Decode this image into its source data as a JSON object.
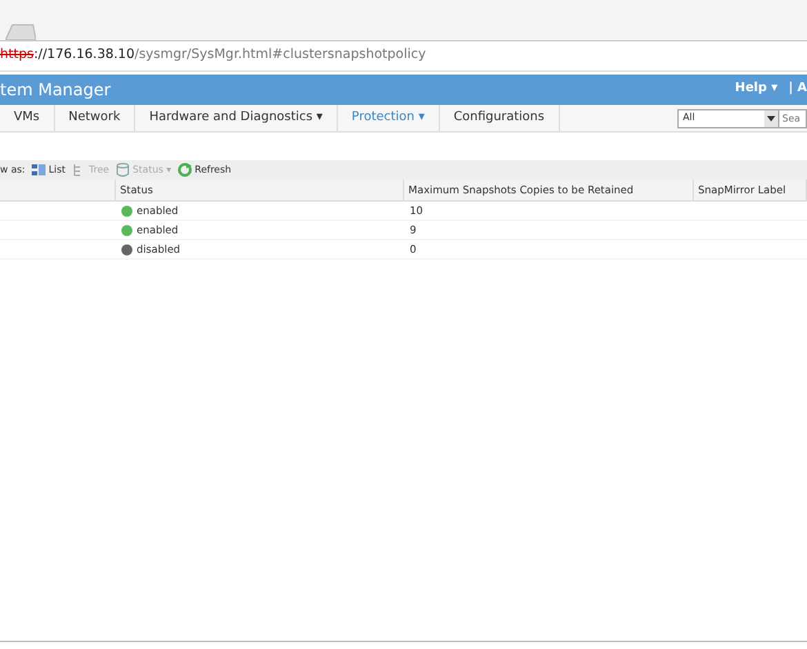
{
  "address_bar": {
    "scheme": "https",
    "host": "://176.16.38.10",
    "path": "/sysmgr/SysMgr.html#clustersnapshotpolicy"
  },
  "header": {
    "title": "tem Manager",
    "help": "Help",
    "help_caret": "▾",
    "next": "| A"
  },
  "nav": {
    "items": [
      {
        "label": "VMs",
        "dropdown": false,
        "selected": false
      },
      {
        "label": "Network",
        "dropdown": false,
        "selected": false
      },
      {
        "label": "Hardware and Diagnostics",
        "dropdown": true,
        "selected": false
      },
      {
        "label": "Protection",
        "dropdown": true,
        "selected": true
      },
      {
        "label": "Configurations",
        "dropdown": false,
        "selected": false
      }
    ],
    "caret": "▾",
    "filter": {
      "value": "All"
    },
    "search": {
      "placeholder": "Sea"
    }
  },
  "toolbar": {
    "label": "w as:",
    "items": [
      {
        "kind": "list",
        "label": "List",
        "disabled": false
      },
      {
        "kind": "tree",
        "label": "Tree",
        "disabled": true
      },
      {
        "kind": "status",
        "label": "Status",
        "disabled": true
      },
      {
        "kind": "refresh",
        "label": "Refresh",
        "disabled": false
      }
    ]
  },
  "table": {
    "columns": [
      "Status",
      "Maximum Snapshots Copies to be Retained",
      "SnapMirror Label"
    ],
    "rows": [
      {
        "enabled": true,
        "status": "enabled",
        "max": "10"
      },
      {
        "enabled": true,
        "status": "enabled",
        "max": "9"
      },
      {
        "enabled": false,
        "status": "disabled",
        "max": "0"
      }
    ]
  }
}
